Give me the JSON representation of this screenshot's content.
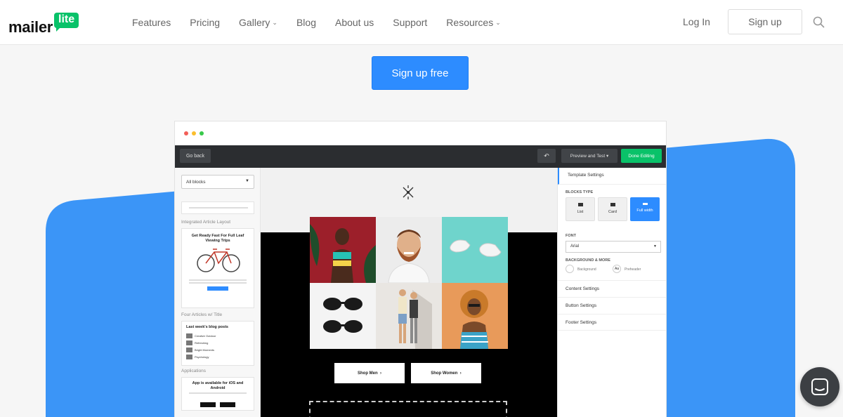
{
  "nav": {
    "logo_word": "mailer",
    "logo_badge": "lite",
    "links": [
      "Features",
      "Pricing",
      "Gallery",
      "Blog",
      "About us",
      "Support",
      "Resources"
    ],
    "login": "Log In",
    "signup": "Sign up"
  },
  "hero": {
    "cta": "Sign up free"
  },
  "editor": {
    "toolbar": {
      "go_back": "Go back",
      "preview": "Preview and Test",
      "done": "Done Editing"
    },
    "left": {
      "select": "All blocks",
      "section1": "Integrated Article Layout",
      "card1_title": "Get Ready Fast For Full Leaf Viewing Trips",
      "section2": "Four Articles w/ Title",
      "card2_title": "Last week's blog posts",
      "articles": [
        "Creative Outdoor",
        "Refreshing",
        "Bright Moments",
        "Psychology"
      ],
      "section3": "Applications",
      "card3_title": "App is available for iOS and Android"
    },
    "canvas": {
      "shop_men": "Shop Men",
      "shop_women": "Shop Women"
    },
    "right": {
      "tab": "Template Settings",
      "blocks_type": "BLOCKS TYPE",
      "types": [
        "List",
        "Card",
        "Full width"
      ],
      "font_label": "FONT",
      "font_value": "Arial",
      "bg_label": "BACKGROUND & MORE",
      "bg_swatch": "Background",
      "preheader_swatch": "Preheader",
      "preheader_glyph": "Aa",
      "rows": [
        "Content Settings",
        "Button Settings",
        "Footer Settings"
      ]
    }
  },
  "colors": {
    "brand_green": "#09c269",
    "accent_blue": "#2d8cff",
    "toolbar_dark": "#2b2d30"
  }
}
